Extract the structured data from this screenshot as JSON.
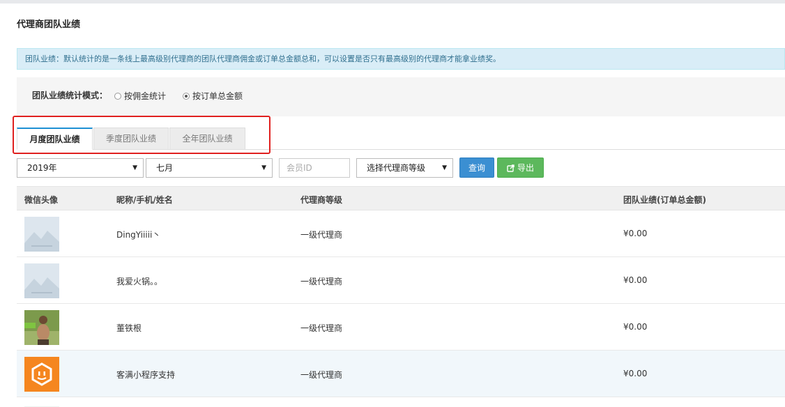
{
  "page": {
    "title": "代理商团队业绩"
  },
  "notice": {
    "text": "团队业绩：默认统计的是一条线上最高级别代理商的团队代理商佣金或订单总金额总和，可以设置是否只有最高级别的代理商才能拿业绩奖。"
  },
  "mode": {
    "label": "团队业绩统计模式：",
    "options": [
      {
        "label": "按佣金统计",
        "checked": false
      },
      {
        "label": "按订单总金额",
        "checked": true
      }
    ]
  },
  "tabs": [
    {
      "label": "月度团队业绩",
      "active": true
    },
    {
      "label": "季度团队业绩",
      "active": false
    },
    {
      "label": "全年团队业绩",
      "active": false
    }
  ],
  "filters": {
    "year": "2019年",
    "month": "七月",
    "member_id_placeholder": "会员ID",
    "level": "选择代理商等级",
    "query_label": "查询",
    "export_label": "导出"
  },
  "table": {
    "headers": [
      "微信头像",
      "昵称/手机/姓名",
      "代理商等级",
      "团队业绩(订单总金额)"
    ],
    "rows": [
      {
        "avatar": "placeholder-image",
        "name": "DingYiiiii丶",
        "level": "一级代理商",
        "amount": "¥0.00"
      },
      {
        "avatar": "placeholder-image",
        "name": "我爱火锅。。",
        "level": "一级代理商",
        "amount": "¥0.00"
      },
      {
        "avatar": "person-photo",
        "name": "董铁根",
        "level": "一级代理商",
        "amount": "¥0.00"
      },
      {
        "avatar": "orange-robot-logo",
        "name": "客满小程序支持",
        "level": "一级代理商",
        "amount": "¥0.00"
      }
    ]
  },
  "colors": {
    "accent": "#3b8fd2",
    "export": "#5cb85c",
    "highlight": "#e0201f",
    "notice_bg": "#d9edf7"
  }
}
